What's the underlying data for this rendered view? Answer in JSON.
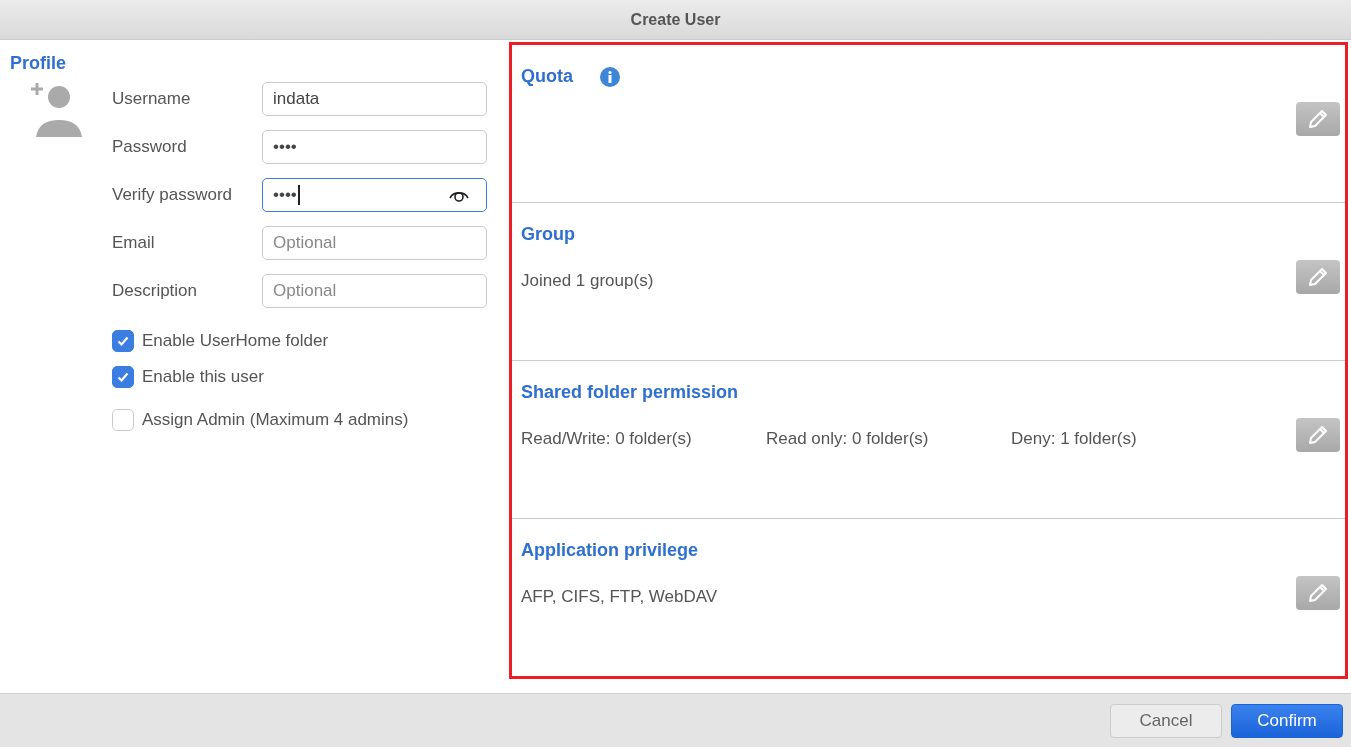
{
  "window": {
    "title": "Create User"
  },
  "profile": {
    "title": "Profile",
    "fields": [
      {
        "label": "Username",
        "value": "indata",
        "focused": false,
        "reveal_toggle": false
      },
      {
        "label": "Password",
        "value": "••••",
        "focused": false,
        "reveal_toggle": false
      },
      {
        "label": "Verify password",
        "value": "••••",
        "focused": true,
        "reveal_toggle": true
      },
      {
        "label": "Email",
        "placeholder": "Optional",
        "focused": false,
        "reveal_toggle": false
      },
      {
        "label": "Description",
        "placeholder": "Optional",
        "focused": false,
        "reveal_toggle": false
      }
    ],
    "options": [
      {
        "label": "Enable UserHome folder",
        "checked": true
      },
      {
        "label": "Enable this user",
        "checked": true
      },
      {
        "label": "Assign Admin (Maximum 4 admins)",
        "checked": false
      }
    ]
  },
  "settings": {
    "highlighted": true,
    "sections": [
      {
        "title": "Quota",
        "info": true
      },
      {
        "title": "Group",
        "info": false,
        "details": [
          "Joined 1 group(s)"
        ]
      },
      {
        "title": "Shared folder permission",
        "info": false,
        "details": [
          "Read/Write: 0 folder(s)",
          "Read only: 0 folder(s)",
          "Deny: 1 folder(s)"
        ]
      },
      {
        "title": "Application privilege",
        "info": false,
        "details": [
          "AFP, CIFS, FTP, WebDAV"
        ]
      }
    ]
  },
  "buttons": [
    {
      "label": "Cancel",
      "kind": "secondary"
    },
    {
      "label": "Confirm",
      "kind": "primary"
    }
  ]
}
